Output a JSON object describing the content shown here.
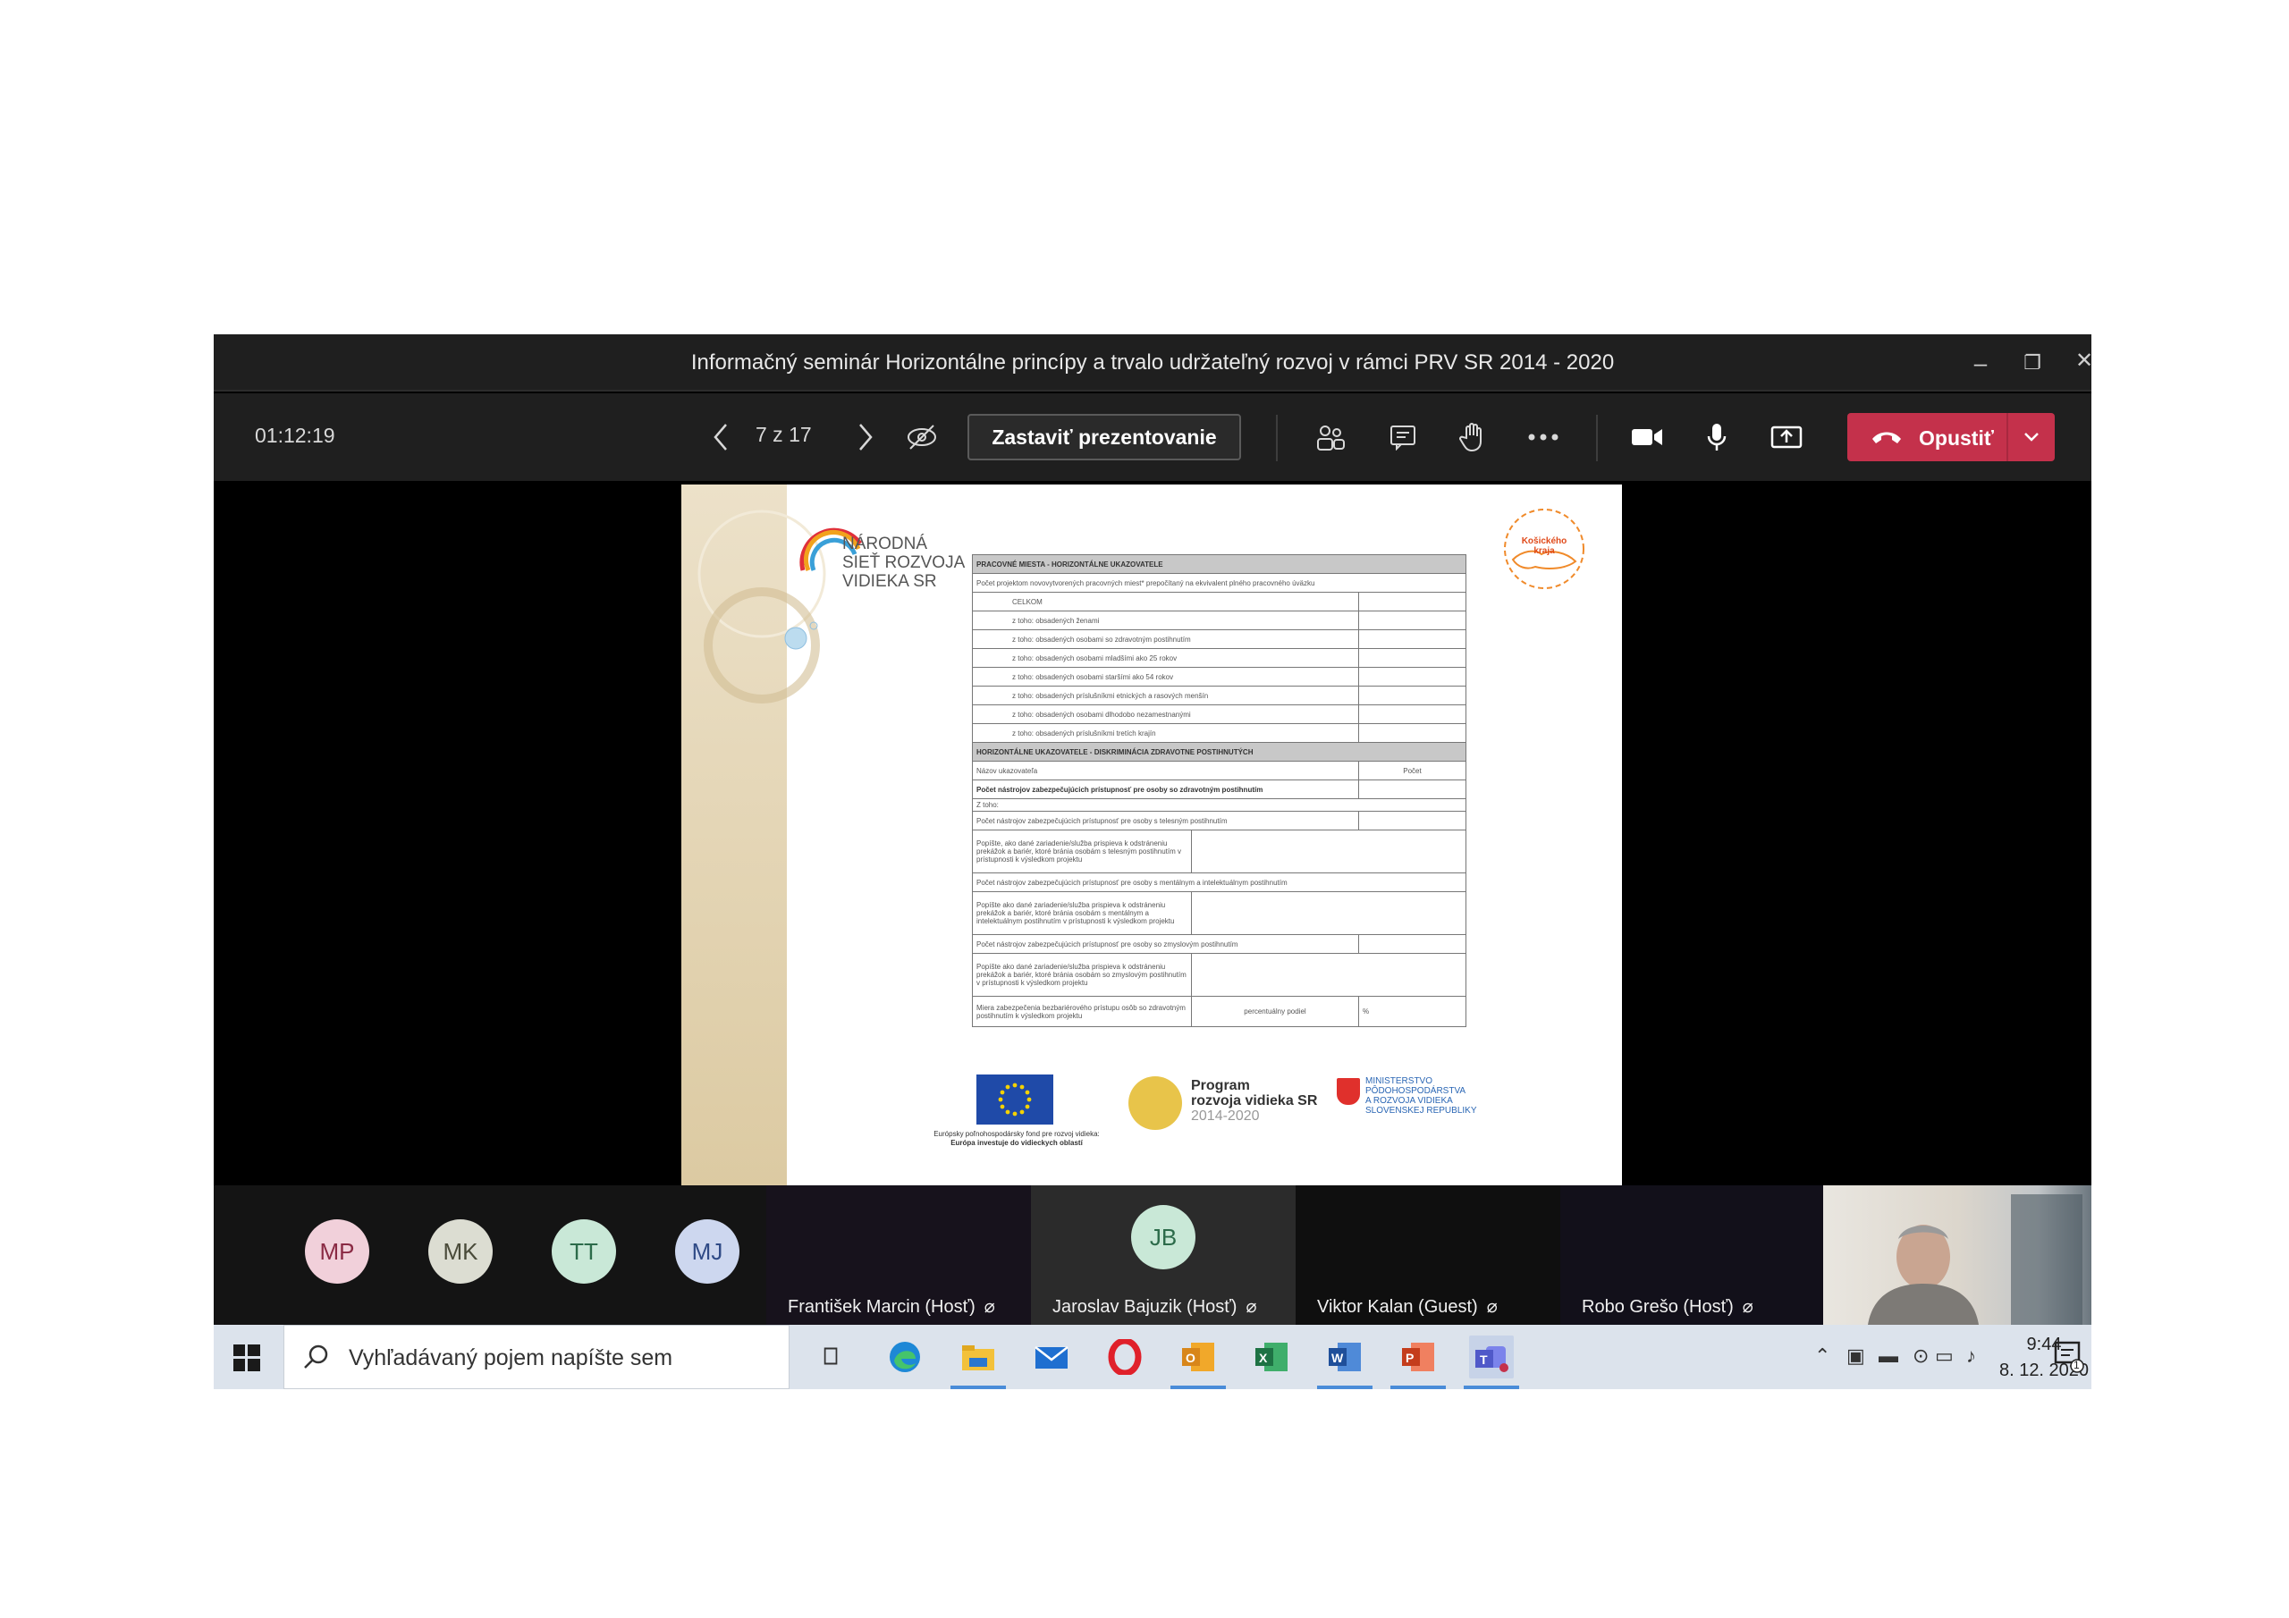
{
  "window": {
    "title": "Informačný seminár Horizontálne princípy a trvalo udržateľný rozvoj v rámci PRV SR 2014 - 2020",
    "controls": [
      "minimize",
      "restore",
      "close"
    ]
  },
  "toolbar": {
    "timer": "01:12:19",
    "page_count": "7 z 17",
    "stop_presenting_label": "Zastaviť prezentovanie",
    "leave_label": "Opustiť",
    "icons": [
      "chevron-left-icon",
      "chevron-right-icon",
      "eye-off-icon",
      "participants-icon",
      "chat-icon",
      "raise-hand-icon",
      "more-icon",
      "camera-icon",
      "microphone-icon",
      "share-icon",
      "phone-hangup-icon",
      "chevron-down-icon"
    ],
    "leave_color": "#c4314b"
  },
  "slide": {
    "brand_line1": "NÁRODNÁ",
    "brand_line2": "SIEŤ ROZVOJA",
    "brand_line3": "VIDIEKA SR",
    "kraj_stamp": "Košického kraja",
    "table": {
      "section1_title": "PRACOVNÉ MIESTA - HORIZONTÁLNE UKAZOVATELE",
      "section1_intro": "Počet projektom novovytvorených pracovných miest* prepočítaný na ekvivalent plného pracovného úväzku",
      "section1_rows": [
        "CELKOM",
        "z toho: obsadených ženami",
        "z toho: obsadených osobami so zdravotným postihnutím",
        "z toho: obsadených osobami mladšími ako 25 rokov",
        "z toho: obsadených osobami staršími ako 54 rokov",
        "z toho: obsadených príslušníkmi etnických a rasových menšín",
        "z toho: obsadených osobami dlhodobo nezamestnanými",
        "z toho: obsadených príslušníkmi tretích krajín"
      ],
      "section2_title": "HORIZONTÁLNE UKAZOVATELE - DISKRIMINÁCIA ZDRAVOTNE POSTIHNUTÝCH",
      "section2_col1": "Názov ukazovateľa",
      "section2_col2": "Počet",
      "section2_total": "Počet nástrojov zabezpečujúcich prístupnosť pre osoby so zdravotným postihnutím",
      "section2_ztoho": "Z toho:",
      "section2_physical": "Počet nástrojov zabezpečujúcich prístupnosť pre osoby s telesným postihnutím",
      "section2_physical_desc": "Popíšte, ako dané zariadenie/služba prispieva k odstráneniu prekážok a bariér, ktoré bránia osobám s telesným postihnutím v prístupnosti k výsledkom projektu",
      "section2_mental": "Počet nástrojov zabezpečujúcich prístupnosť pre osoby s mentálnym a intelektuálnym postihnutím",
      "section2_mental_desc": "Popíšte ako dané zariadenie/služba prispieva k odstráneniu prekážok a bariér, ktoré bránia osobám s mentálnym a intelektuálnym postihnutím v prístupnosti k výsledkom projektu",
      "section2_sensory": "Počet nástrojov zabezpečujúcich prístupnosť pre osoby so zmyslovým postihnutím",
      "section2_sensory_desc": "Popíšte ako dané zariadenie/služba prispieva k odstráneniu prekážok a bariér, ktoré bránia osobám so zmyslovým postihnutím v prístupnosti k výsledkom projektu",
      "section2_measure": "Miera zabezpečenia bezbariérového prístupu osôb so zdravotným postihnutím k výsledkom projektu",
      "section2_measure_value": "percentuálny podiel",
      "section2_measure_unit": "%"
    },
    "eu_caption_line1": "Európsky poľnohospodársky fond pre rozvoj vidieka:",
    "eu_caption_line2": "Európa investuje do vidieckych oblastí",
    "prv_line1": "Program",
    "prv_line2": "rozvoja vidieka SR",
    "prv_years": "2014-2020",
    "ministry_line1": "MINISTERSTVO",
    "ministry_line2": "PÔDOHOSPODÁRSTVA",
    "ministry_line3": "A ROZVOJA VIDIEKA",
    "ministry_line4": "SLOVENSKEJ REPUBLIKY"
  },
  "participants": {
    "avatars": [
      {
        "initials": "MP",
        "bg": "#f1d0da",
        "fg": "#8a2a44"
      },
      {
        "initials": "MK",
        "bg": "#dcddd2",
        "fg": "#4a4b3a"
      },
      {
        "initials": "TT",
        "bg": "#c9e8d7",
        "fg": "#2c6b4a"
      },
      {
        "initials": "MJ",
        "bg": "#cdd7ef",
        "fg": "#2f4a86"
      }
    ],
    "tiles": [
      {
        "name": "František Marcin (Hosť)"
      },
      {
        "name": "Jaroslav Bajuzik (Hosť)",
        "initials": "JB"
      },
      {
        "name": "Viktor Kalan (Guest)"
      },
      {
        "name": "Robo Grešo (Hosť)"
      }
    ]
  },
  "taskbar": {
    "search_placeholder": "Vyhľadávaný pojem napíšte sem",
    "apps": [
      "task-view-icon",
      "edge-icon",
      "file-explorer-icon",
      "mail-icon",
      "opera-icon",
      "outlook-icon",
      "excel-icon",
      "word-icon",
      "powerpoint-icon",
      "teams-icon"
    ],
    "time": "9:44",
    "date": "8. 12. 2020",
    "notification_count": "1"
  }
}
